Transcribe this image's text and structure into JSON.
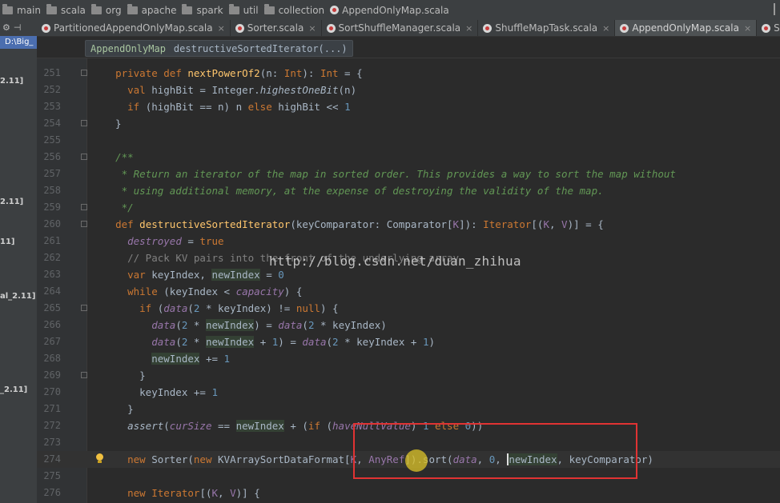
{
  "breadcrumbs": [
    {
      "label": "main",
      "icon": "folder-icon"
    },
    {
      "label": "scala",
      "icon": "folder-icon"
    },
    {
      "label": "org",
      "icon": "folder-icon"
    },
    {
      "label": "apache",
      "icon": "folder-icon"
    },
    {
      "label": "spark",
      "icon": "folder-icon"
    },
    {
      "label": "util",
      "icon": "folder-icon"
    },
    {
      "label": "collection",
      "icon": "folder-icon"
    },
    {
      "label": "AppendOnlyMap.scala",
      "icon": "scala-file-icon"
    }
  ],
  "tabs": [
    {
      "label": "PartitionedAppendOnlyMap.scala",
      "active": false
    },
    {
      "label": "Sorter.scala",
      "active": false
    },
    {
      "label": "SortShuffleManager.scala",
      "active": false
    },
    {
      "label": "ShuffleMapTask.scala",
      "active": false
    },
    {
      "label": "AppendOnlyMap.scala",
      "active": true
    },
    {
      "label": "SortDataFormat.scala",
      "active": false
    }
  ],
  "tab_close_glyph": "×",
  "project_panel": {
    "path": "D:\\Big_",
    "items": [
      "2.11]",
      "2.11]",
      "11]",
      "al_2.11]",
      "_2.11]"
    ]
  },
  "scope": {
    "class_name": "AppendOnlyMap",
    "method": "destructiveSortedIterator(...)"
  },
  "watermark": "http://blog.csdn.net/duan_zhihua",
  "code_lines": [
    {
      "n": "251",
      "fold": true,
      "segs": [
        [
          "",
          "  "
        ],
        [
          "kw",
          "private def "
        ],
        [
          "fn",
          "nextPowerOf2"
        ],
        [
          "",
          "(n: "
        ],
        [
          "kw",
          "Int"
        ],
        [
          "",
          "): "
        ],
        [
          "kw",
          "Int"
        ],
        [
          "",
          " = {"
        ]
      ]
    },
    {
      "n": "252",
      "segs": [
        [
          "",
          "    "
        ],
        [
          "kw",
          "val "
        ],
        [
          "",
          "highBit = Integer."
        ],
        [
          "sm",
          "highestOneBit"
        ],
        [
          "",
          "(n)"
        ]
      ]
    },
    {
      "n": "253",
      "segs": [
        [
          "",
          "    "
        ],
        [
          "kw",
          "if "
        ],
        [
          "",
          "(highBit == n) n "
        ],
        [
          "kw",
          "else "
        ],
        [
          "",
          "highBit << "
        ],
        [
          "num",
          "1"
        ]
      ]
    },
    {
      "n": "254",
      "fold": true,
      "segs": [
        [
          "",
          "  }"
        ]
      ]
    },
    {
      "n": "255",
      "segs": []
    },
    {
      "n": "256",
      "fold": true,
      "segs": [
        [
          "",
          "  "
        ],
        [
          "dc",
          "/**"
        ]
      ]
    },
    {
      "n": "257",
      "segs": [
        [
          "",
          "   "
        ],
        [
          "dc",
          "* Return an iterator of the map in sorted order. This provides a way to sort the map without"
        ]
      ]
    },
    {
      "n": "258",
      "segs": [
        [
          "",
          "   "
        ],
        [
          "dc",
          "* using additional memory, at the expense of destroying the validity of the map."
        ]
      ]
    },
    {
      "n": "259",
      "fold": true,
      "segs": [
        [
          "",
          "   "
        ],
        [
          "dc",
          "*/"
        ]
      ]
    },
    {
      "n": "260",
      "fold": true,
      "segs": [
        [
          "",
          "  "
        ],
        [
          "kw",
          "def "
        ],
        [
          "fn",
          "destructiveSortedIterator"
        ],
        [
          "",
          "(keyComparator: Comparator["
        ],
        [
          "tp",
          "K"
        ],
        [
          "",
          "]): "
        ],
        [
          "kw",
          "Iterator"
        ],
        [
          "",
          "[("
        ],
        [
          "tp",
          "K"
        ],
        [
          "",
          ", "
        ],
        [
          "tp",
          "V"
        ],
        [
          "",
          ")] = {"
        ]
      ]
    },
    {
      "n": "261",
      "segs": [
        [
          "",
          "    "
        ],
        [
          "it",
          "destroyed"
        ],
        [
          "",
          " = "
        ],
        [
          "kw",
          "true"
        ]
      ]
    },
    {
      "n": "262",
      "segs": [
        [
          "",
          "    "
        ],
        [
          "cm",
          "// Pack KV pairs into the front of the underlying array"
        ]
      ]
    },
    {
      "n": "263",
      "segs": [
        [
          "",
          "    "
        ],
        [
          "kw",
          "var "
        ],
        [
          "",
          "keyIndex, "
        ],
        [
          "hl",
          "newIndex"
        ],
        [
          "",
          " = "
        ],
        [
          "num",
          "0"
        ]
      ]
    },
    {
      "n": "264",
      "segs": [
        [
          "",
          "    "
        ],
        [
          "kw",
          "while "
        ],
        [
          "",
          "(keyIndex < "
        ],
        [
          "it",
          "capacity"
        ],
        [
          "",
          ") {"
        ]
      ]
    },
    {
      "n": "265",
      "fold": true,
      "segs": [
        [
          "",
          "      "
        ],
        [
          "kw",
          "if "
        ],
        [
          "",
          "("
        ],
        [
          "it",
          "data"
        ],
        [
          "",
          "("
        ],
        [
          "num",
          "2"
        ],
        [
          "",
          " * keyIndex) != "
        ],
        [
          "kw",
          "null"
        ],
        [
          "",
          ") {"
        ]
      ]
    },
    {
      "n": "266",
      "segs": [
        [
          "",
          "        "
        ],
        [
          "it",
          "data"
        ],
        [
          "",
          "("
        ],
        [
          "num",
          "2"
        ],
        [
          "",
          " * "
        ],
        [
          "hl",
          "newIndex"
        ],
        [
          "",
          ") = "
        ],
        [
          "it",
          "data"
        ],
        [
          "",
          "("
        ],
        [
          "num",
          "2"
        ],
        [
          "",
          " * keyIndex)"
        ]
      ]
    },
    {
      "n": "267",
      "segs": [
        [
          "",
          "        "
        ],
        [
          "it",
          "data"
        ],
        [
          "",
          "("
        ],
        [
          "num",
          "2"
        ],
        [
          "",
          " * "
        ],
        [
          "hl",
          "newIndex"
        ],
        [
          "",
          " + "
        ],
        [
          "num",
          "1"
        ],
        [
          "",
          ") = "
        ],
        [
          "it",
          "data"
        ],
        [
          "",
          "("
        ],
        [
          "num",
          "2"
        ],
        [
          "",
          " * keyIndex + "
        ],
        [
          "num",
          "1"
        ],
        [
          "",
          ")"
        ]
      ]
    },
    {
      "n": "268",
      "segs": [
        [
          "",
          "        "
        ],
        [
          "hl",
          "newIndex"
        ],
        [
          "",
          " += "
        ],
        [
          "num",
          "1"
        ]
      ]
    },
    {
      "n": "269",
      "fold": true,
      "segs": [
        [
          "",
          "      }"
        ]
      ]
    },
    {
      "n": "270",
      "segs": [
        [
          "",
          "      keyIndex += "
        ],
        [
          "num",
          "1"
        ]
      ]
    },
    {
      "n": "271",
      "segs": [
        [
          "",
          "    }"
        ]
      ]
    },
    {
      "n": "272",
      "segs": [
        [
          "",
          "    "
        ],
        [
          "sm",
          "assert"
        ],
        [
          "",
          "("
        ],
        [
          "it",
          "curSize"
        ],
        [
          "",
          " == "
        ],
        [
          "hl",
          "newIndex"
        ],
        [
          "",
          " + ("
        ],
        [
          "kw",
          "if "
        ],
        [
          "",
          "("
        ],
        [
          "it",
          "haveNullValue"
        ],
        [
          "",
          ") "
        ],
        [
          "num",
          "1 "
        ],
        [
          "kw",
          "else "
        ],
        [
          "num",
          "0"
        ],
        [
          "",
          "))"
        ]
      ]
    },
    {
      "n": "273",
      "segs": []
    },
    {
      "n": "274",
      "current": true,
      "bulb": true,
      "segs": [
        [
          "",
          "    "
        ],
        [
          "kw",
          "new "
        ],
        [
          "",
          "Sorter("
        ],
        [
          "kw",
          "new "
        ],
        [
          "",
          "KVArraySortDataFormat["
        ],
        [
          "tp",
          "K"
        ],
        [
          "",
          ", "
        ],
        [
          "tp",
          "AnyRef"
        ],
        [
          "",
          "]).sort("
        ],
        [
          "it",
          "data"
        ],
        [
          "",
          ", "
        ],
        [
          "num",
          "0"
        ],
        [
          "",
          ", "
        ],
        [
          "caret",
          "newIndex"
        ],
        [
          "",
          ", keyComparator)"
        ]
      ]
    },
    {
      "n": "275",
      "segs": []
    },
    {
      "n": "276",
      "segs": [
        [
          "",
          "    "
        ],
        [
          "kw",
          "new "
        ],
        [
          "kw",
          "Iterator"
        ],
        [
          "",
          "[("
        ],
        [
          "tp",
          "K"
        ],
        [
          "",
          ", "
        ],
        [
          "tp",
          "V"
        ],
        [
          "",
          ")] {"
        ]
      ]
    }
  ]
}
